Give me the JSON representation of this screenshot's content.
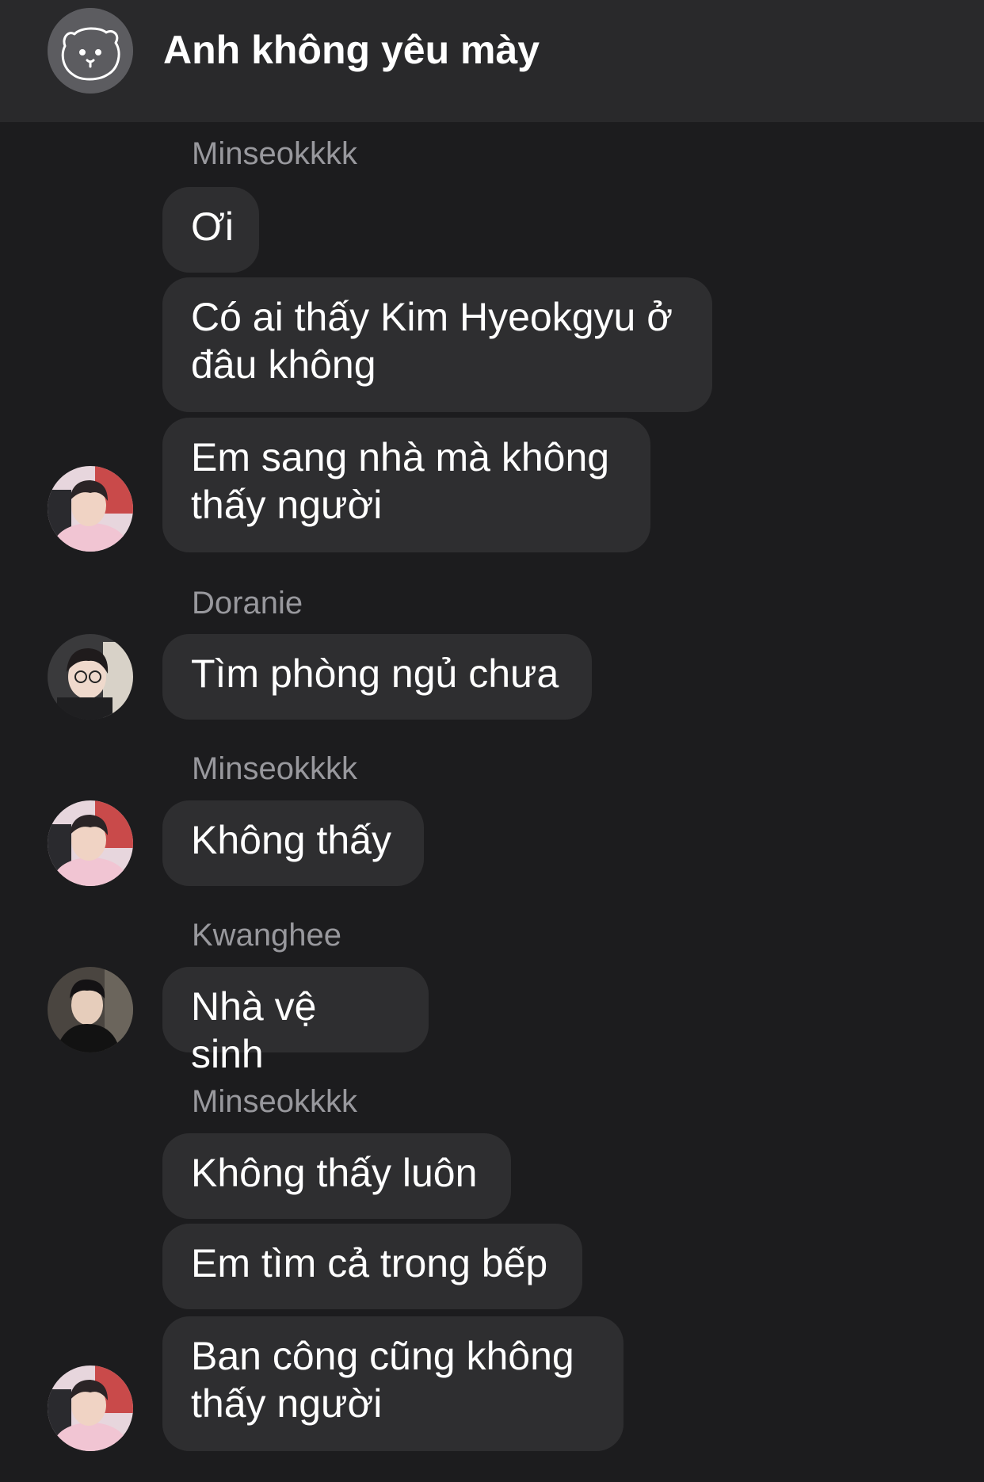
{
  "header": {
    "title": "Anh không yêu mày",
    "avatar_icon": "bear-icon"
  },
  "messages": [
    {
      "sender": "Minseokkkk",
      "text": "Ơi"
    },
    {
      "text": "Có ai thấy Kim Hyeokgyu ở đâu không"
    },
    {
      "text": "Em sang nhà mà không thấy người"
    },
    {
      "sender": "Doranie",
      "text": "Tìm phòng ngủ chưa"
    },
    {
      "sender": "Minseokkkk",
      "text": "Không thấy"
    },
    {
      "sender": "Kwanghee",
      "text": "Nhà vệ sinh"
    },
    {
      "sender": "Minseokkkk",
      "text": "Không thấy luôn"
    },
    {
      "text": "Em tìm cả trong bếp"
    },
    {
      "text": "Ban công cũng không thấy người"
    }
  ],
  "colors": {
    "background": "#1c1c1e",
    "header": "#29292b",
    "bubble": "#2e2e30",
    "sender_name": "#98989d"
  }
}
